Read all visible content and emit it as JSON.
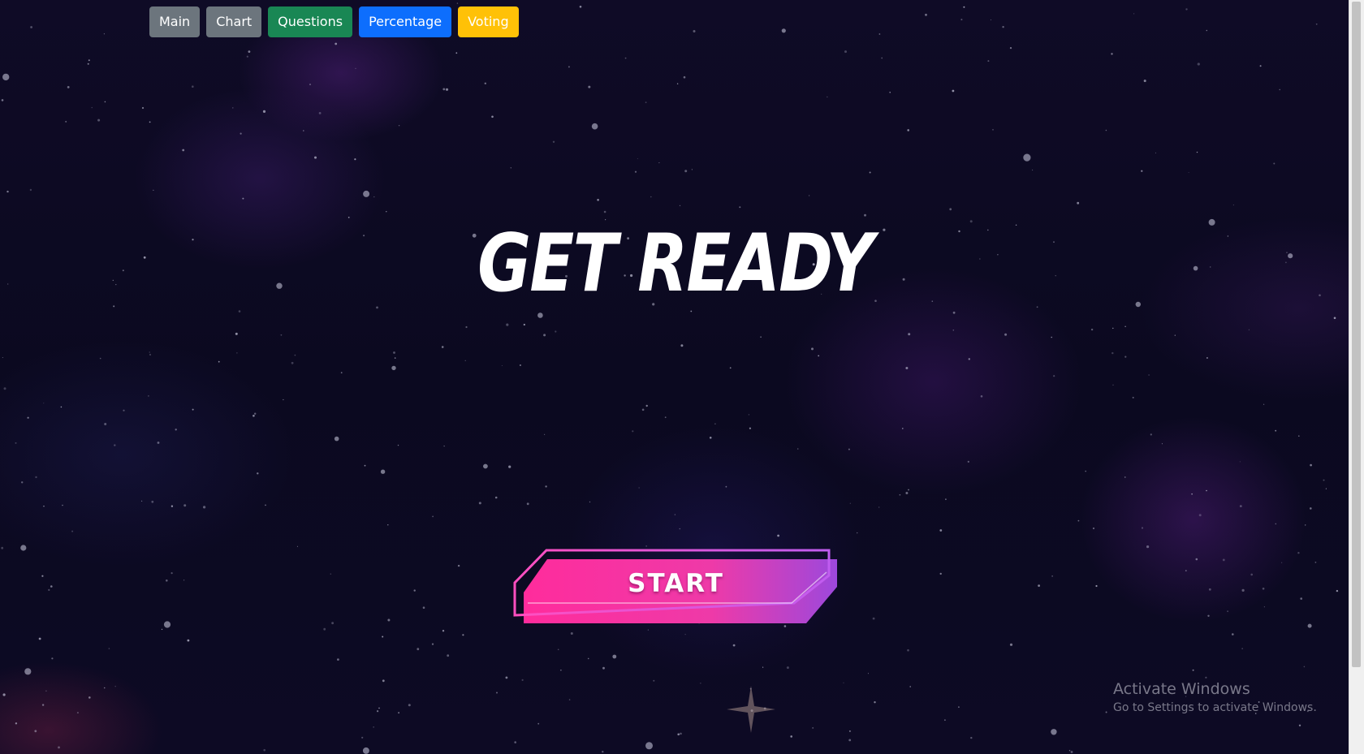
{
  "nav": {
    "buttons": [
      {
        "label": "Main",
        "color": "#6c757d"
      },
      {
        "label": "Chart",
        "color": "#6c757d"
      },
      {
        "label": "Questions",
        "color": "#198754"
      },
      {
        "label": "Percentage",
        "color": "#0d6efd"
      },
      {
        "label": "Voting",
        "color": "#ffc107"
      }
    ]
  },
  "main": {
    "headline": "GET READY",
    "start_label": "START"
  },
  "watermark": {
    "title": "Activate Windows",
    "subtitle": "Go to Settings to activate Windows."
  },
  "colors": {
    "background": "#0d0a22",
    "start_gradient_from": "#ff2fa0",
    "start_gradient_to": "#a24be0"
  }
}
